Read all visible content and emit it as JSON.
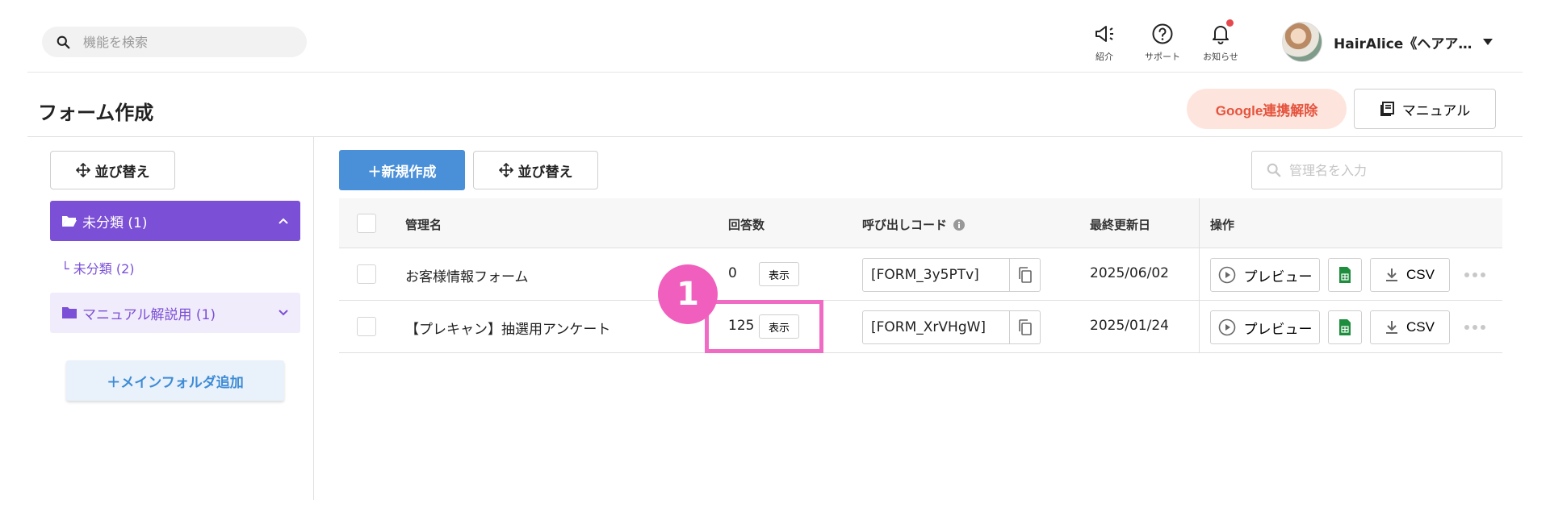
{
  "search": {
    "placeholder": "機能を検索"
  },
  "topnav": {
    "intro_label": "紹介",
    "support_label": "サポート",
    "notifications_label": "お知らせ",
    "account_name": "HairAlice《ヘアア…"
  },
  "page": {
    "title": "フォーム作成",
    "google_unlink_label": "Google連携解除",
    "manual_label": "マニュアル"
  },
  "sidebar": {
    "sort_label": "並び替え",
    "folders": [
      {
        "label": "未分類 (1)",
        "state": "expanded"
      },
      {
        "label": "マニュアル解説用 (1)",
        "state": "collapsed"
      }
    ],
    "subfolder_prefix": "└",
    "subfolder_label": "未分類 (2)",
    "add_folder_label": "＋メインフォルダ追加"
  },
  "toolbar": {
    "new_label": "＋新規作成",
    "sort_label": "並び替え",
    "search_placeholder": "管理名を入力"
  },
  "table": {
    "headers": {
      "name": "管理名",
      "responses": "回答数",
      "code": "呼び出しコード",
      "updated": "最終更新日",
      "actions": "操作"
    },
    "show_label": "表示",
    "preview_label": "プレビュー",
    "csv_label": "CSV",
    "rows": [
      {
        "name": "お客様情報フォーム",
        "responses": "0",
        "code": "[FORM_3y5PTv]",
        "updated": "2025/06/02"
      },
      {
        "name": "【プレキャン】抽選用アンケート",
        "responses": "125",
        "code": "[FORM_XrVHgW]",
        "updated": "2025/01/24"
      }
    ]
  },
  "annotation": {
    "marker": "1"
  },
  "colors": {
    "accent_purple": "#7b4fd6",
    "primary_blue": "#4a90d9",
    "google_red": "#e5533d",
    "highlight_pink": "#f06bc4",
    "sheet_green": "#1e8e3e"
  }
}
